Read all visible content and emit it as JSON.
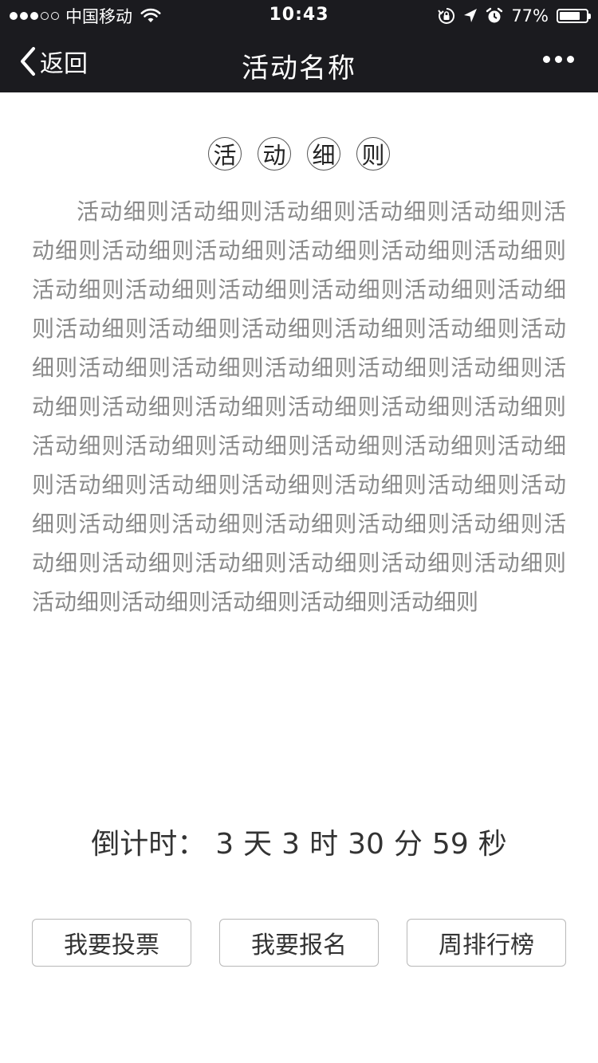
{
  "status_bar": {
    "signal_filled": 3,
    "signal_total": 5,
    "carrier": "中国移动",
    "time": "10:43",
    "battery_percent": "77%",
    "battery_level": 0.77
  },
  "nav": {
    "back_label": "返回",
    "title": "活动名称"
  },
  "section": {
    "title_chars": [
      "活",
      "动",
      "细",
      "则"
    ],
    "body_text": "活动细则活动细则活动细则活动细则活动细则活动细则活动细则活动细则活动细则活动细则活动细则活动细则活动细则活动细则活动细则活动细则活动细则活动细则活动细则活动细则活动细则活动细则活动细则活动细则活动细则活动细则活动细则活动细则活动细则活动细则活动细则活动细则活动细则活动细则活动细则活动细则活动细则活动细则活动细则活动细则活动细则活动细则活动细则活动细则活动细则活动细则活动细则活动细则活动细则活动细则活动细则活动细则活动细则活动细则活动细则活动细则活动细则活动细则活动细则活动细则活动细则活动细则"
  },
  "countdown": {
    "label": "倒计时：",
    "days": "3",
    "days_unit": "天",
    "hours": "3",
    "hours_unit": "时",
    "minutes": "30",
    "minutes_unit": "分",
    "seconds": "59",
    "seconds_unit": "秒"
  },
  "actions": {
    "vote_label": "我要投票",
    "signup_label": "我要报名",
    "ranking_label": "周排行榜"
  },
  "colors": {
    "bar_background": "#1b1b1f",
    "body_text": "#8a8a8a",
    "button_border": "#b8b8b8"
  }
}
